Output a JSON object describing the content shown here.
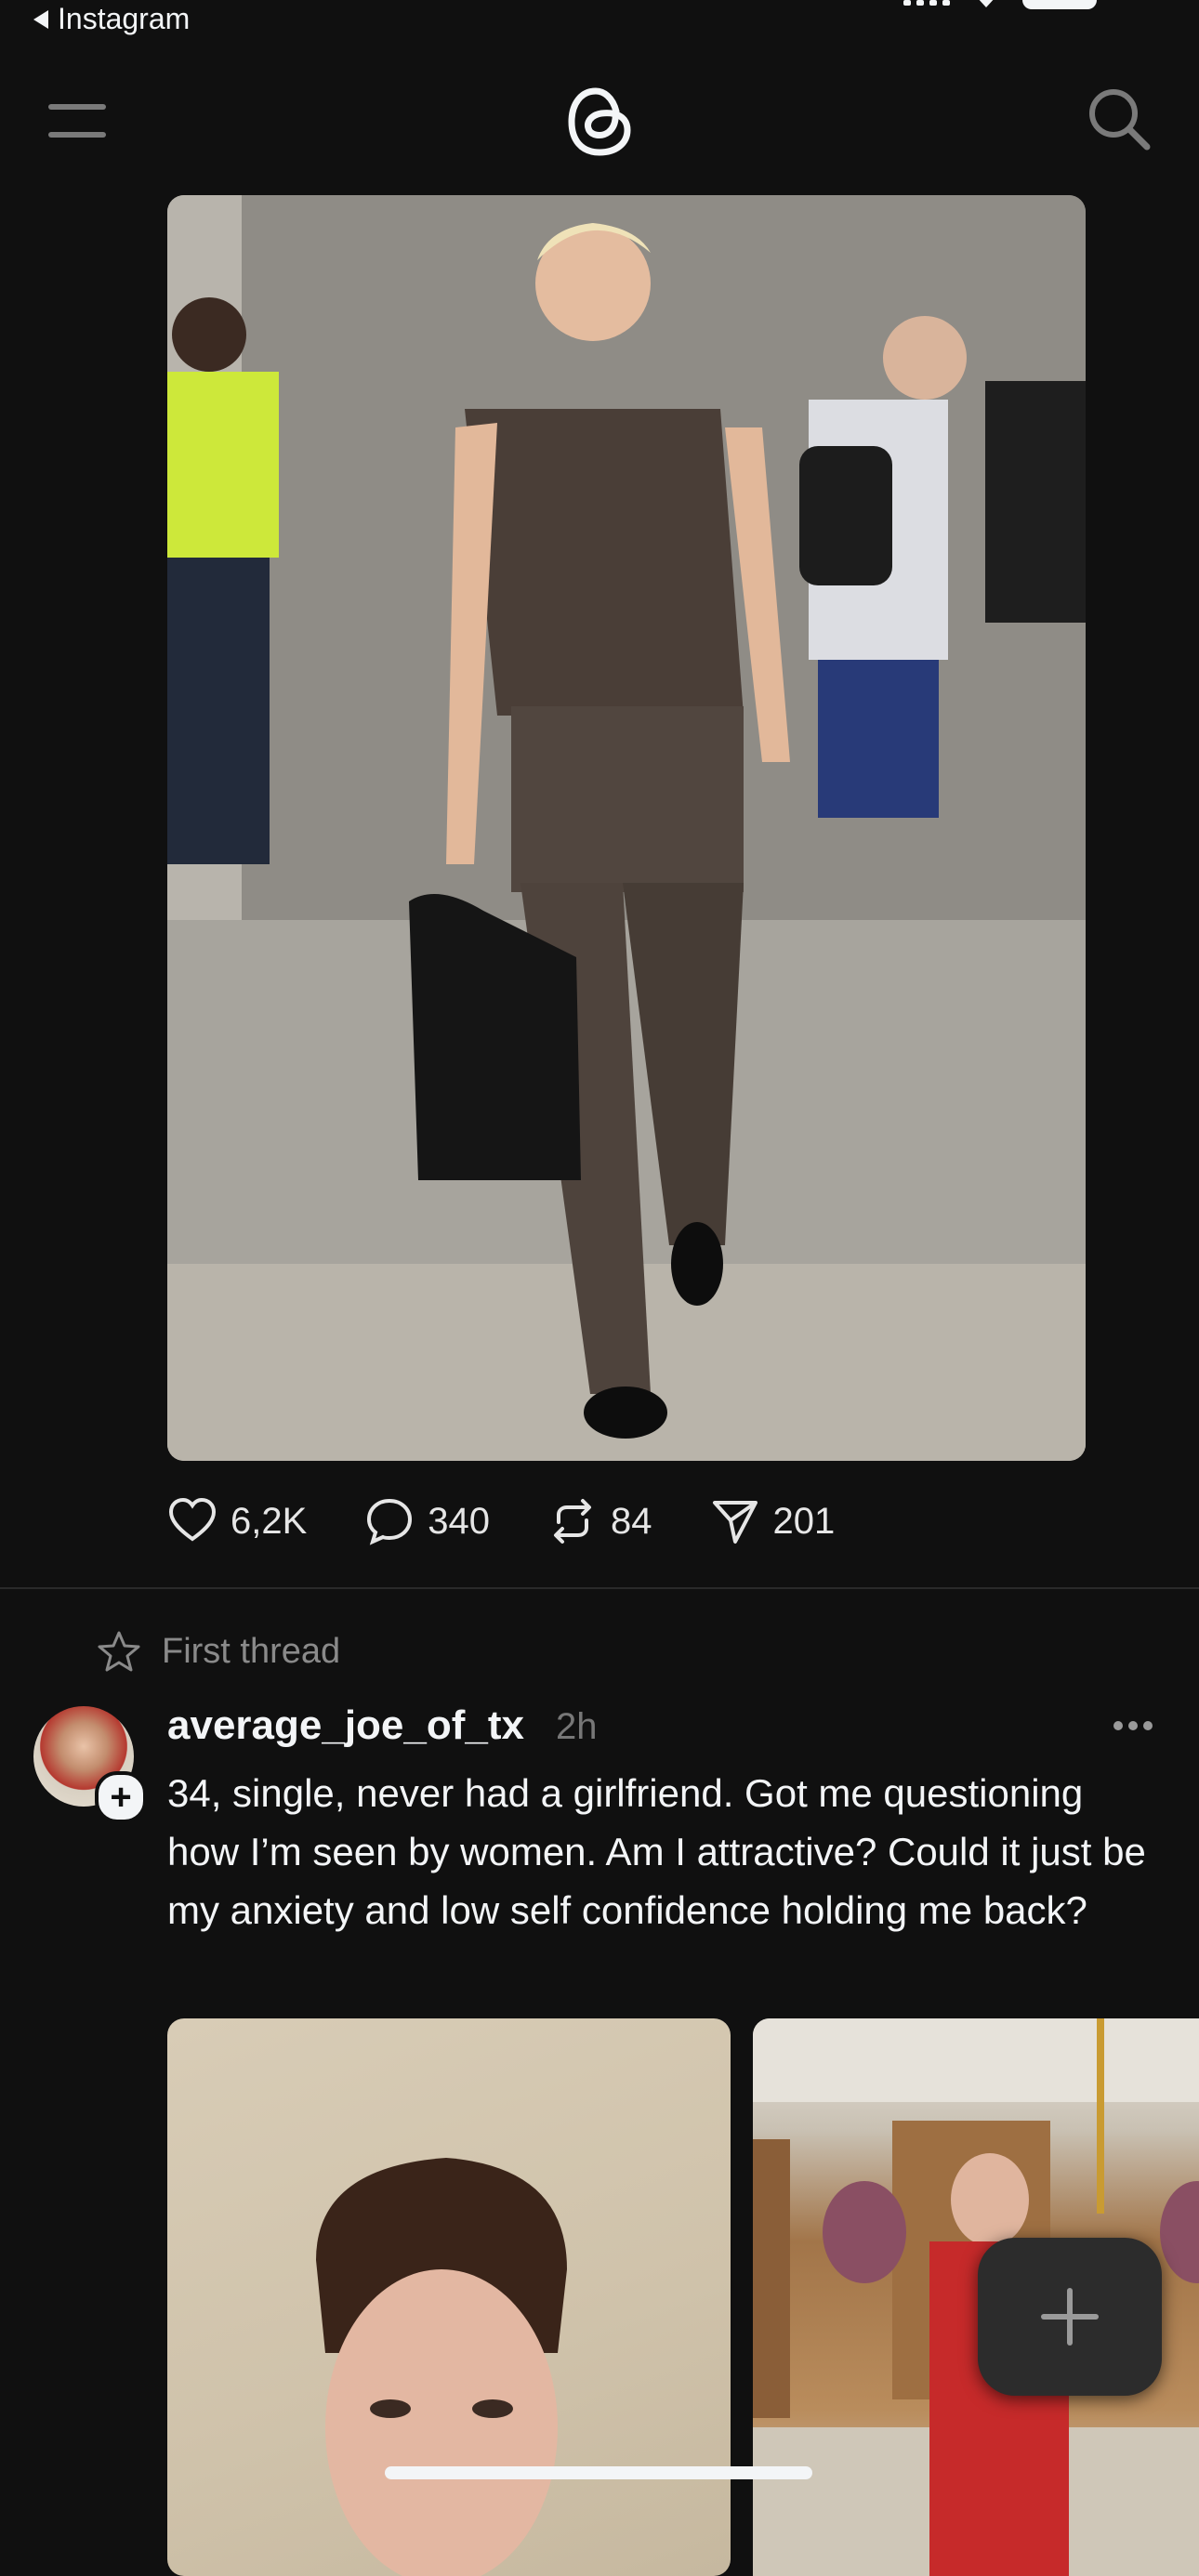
{
  "status": {
    "back_label": "Instagram"
  },
  "header": {
    "menu_icon": "hamburger-icon",
    "logo_icon": "threads-logo",
    "search_icon": "search-icon"
  },
  "post1": {
    "image_alt": "Blond man in brown sleeveless top and trousers carrying a black woven bag",
    "actions": [
      {
        "icon": "heart-icon",
        "count": "6,2K"
      },
      {
        "icon": "comment-icon",
        "count": "340"
      },
      {
        "icon": "repost-icon",
        "count": "84"
      },
      {
        "icon": "share-icon",
        "count": "201"
      }
    ]
  },
  "thread": {
    "first_thread_label": "First thread",
    "username": "average_joe_of_tx",
    "time": "2h",
    "text": "34, single, never had a girlfriend. Got me questioning how I’m seen by women. Am I attractive? Could it just be my anxiety and low self confidence holding me back?"
  },
  "colors": {
    "background": "#101010",
    "text": "#f3f5f7",
    "muted": "#777777"
  }
}
